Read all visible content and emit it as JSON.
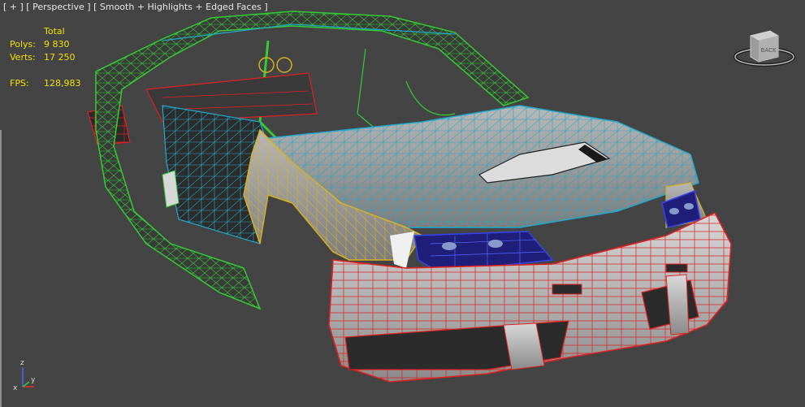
{
  "viewport": {
    "menu_plus": "[ + ]",
    "view_name": "[ Perspective ]",
    "shading_mode": "[ Smooth + Highlights + Edged Faces ]"
  },
  "stats": {
    "header": "Total",
    "polys_label": "Polys:",
    "polys_value": "9 830",
    "verts_label": "Verts:",
    "verts_value": "17 250",
    "fps_label": "FPS:",
    "fps_value": "128,983"
  },
  "viewcube": {
    "face_label": "BACK"
  },
  "axis": {
    "z": "z",
    "x": "x",
    "y": "y"
  },
  "colors": {
    "background": "#444444",
    "stats_text": "#f0e000",
    "wire_green": "#33cc33",
    "wire_cyan": "#22a8cc",
    "wire_yellow": "#d8b020",
    "wire_red": "#dd2222",
    "wire_blue": "#2222cc"
  }
}
